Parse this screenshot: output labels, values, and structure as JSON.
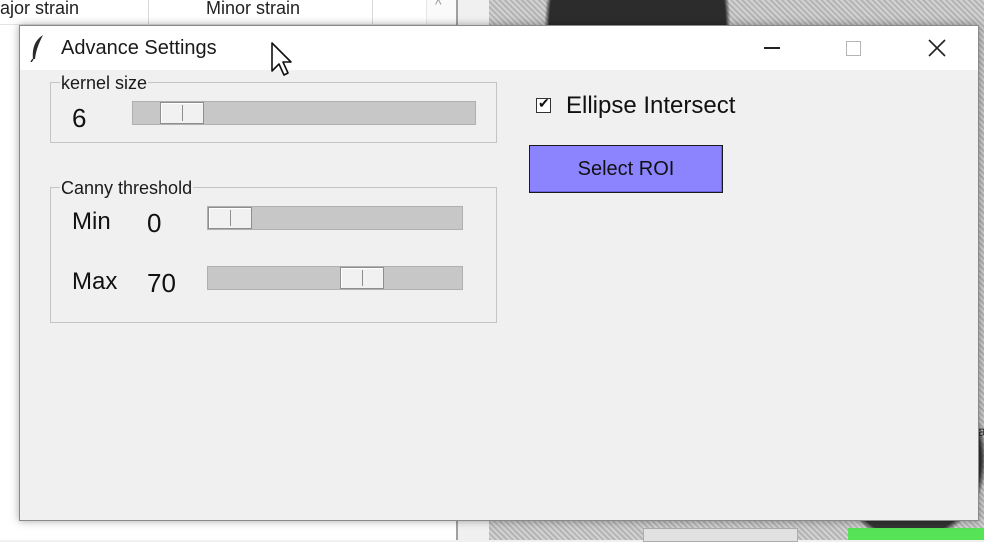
{
  "background_app": {
    "columns": [
      "ajor strain",
      "Minor strain"
    ],
    "scroll_arrow": "^",
    "edge_letter": "a"
  },
  "dialog": {
    "title": "Advance Settings",
    "app_icon": "feather-icon",
    "window_controls": {
      "minimize": "minimize-icon",
      "maximize": "maximize-icon",
      "close": "close-icon"
    }
  },
  "kernel": {
    "legend": "kernel size",
    "value": "6",
    "slider_fraction": 0.09
  },
  "canny": {
    "legend": "Canny threshold",
    "min_label": "Min",
    "min_value": "0",
    "min_fraction": 0.0,
    "max_label": "Max",
    "max_value": "70",
    "max_fraction": 0.63
  },
  "ellipse": {
    "label": "Ellipse Intersect",
    "checked": true,
    "checkmark": "✔"
  },
  "roi_button": {
    "label": "Select ROI",
    "color": "#8c84ff"
  },
  "colors": {
    "dialog_bg": "#f0f0f0",
    "status_green": "#56e356"
  }
}
